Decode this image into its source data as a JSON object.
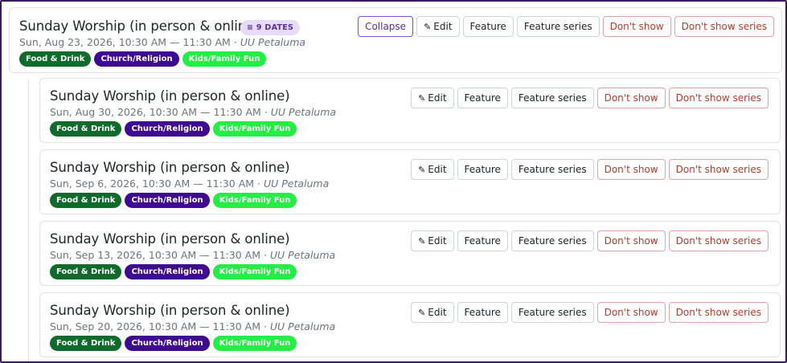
{
  "parent": {
    "title": "Sunday Worship (in person & online)",
    "dates_badge": "≡ 9 DATES",
    "datetime": "Sun, Aug 23, 2026, 10:30 AM — 11:30 AM",
    "separator": " · ",
    "venue": "UU Petaluma",
    "tags": [
      "Food & Drink",
      "Church/Religion",
      "Kids/Family Fun"
    ],
    "buttons": {
      "collapse": "Collapse",
      "edit": "Edit",
      "feature": "Feature",
      "feature_series": "Feature series",
      "dont_show": "Don't show",
      "dont_show_series": "Don't show series"
    }
  },
  "children": [
    {
      "title": "Sunday Worship (in person & online)",
      "datetime": "Sun, Aug 30, 2026, 10:30 AM — 11:30 AM",
      "separator": " · ",
      "venue": "UU Petaluma",
      "tags": [
        "Food & Drink",
        "Church/Religion",
        "Kids/Family Fun"
      ]
    },
    {
      "title": "Sunday Worship (in person & online)",
      "datetime": "Sun, Sep 6, 2026, 10:30 AM — 11:30 AM",
      "separator": " · ",
      "venue": "UU Petaluma",
      "tags": [
        "Food & Drink",
        "Church/Religion",
        "Kids/Family Fun"
      ]
    },
    {
      "title": "Sunday Worship (in person & online)",
      "datetime": "Sun, Sep 13, 2026, 10:30 AM — 11:30 AM",
      "separator": " · ",
      "venue": "UU Petaluma",
      "tags": [
        "Food & Drink",
        "Church/Religion",
        "Kids/Family Fun"
      ]
    },
    {
      "title": "Sunday Worship (in person & online)",
      "datetime": "Sun, Sep 20, 2026, 10:30 AM — 11:30 AM",
      "separator": " · ",
      "venue": "UU Petaluma",
      "tags": [
        "Food & Drink",
        "Church/Religion",
        "Kids/Family Fun"
      ]
    }
  ],
  "child_buttons": {
    "edit": "Edit",
    "feature": "Feature",
    "feature_series": "Feature series",
    "dont_show": "Don't show",
    "dont_show_series": "Don't show series"
  },
  "colors": {
    "food_drink": "#0f6b2b",
    "church_religion": "#3d0a91",
    "kids_family": "#22ee44",
    "accent_purple": "#5a2ba8",
    "danger": "#c0392b"
  },
  "icons": {
    "edit": "pencil-icon"
  }
}
